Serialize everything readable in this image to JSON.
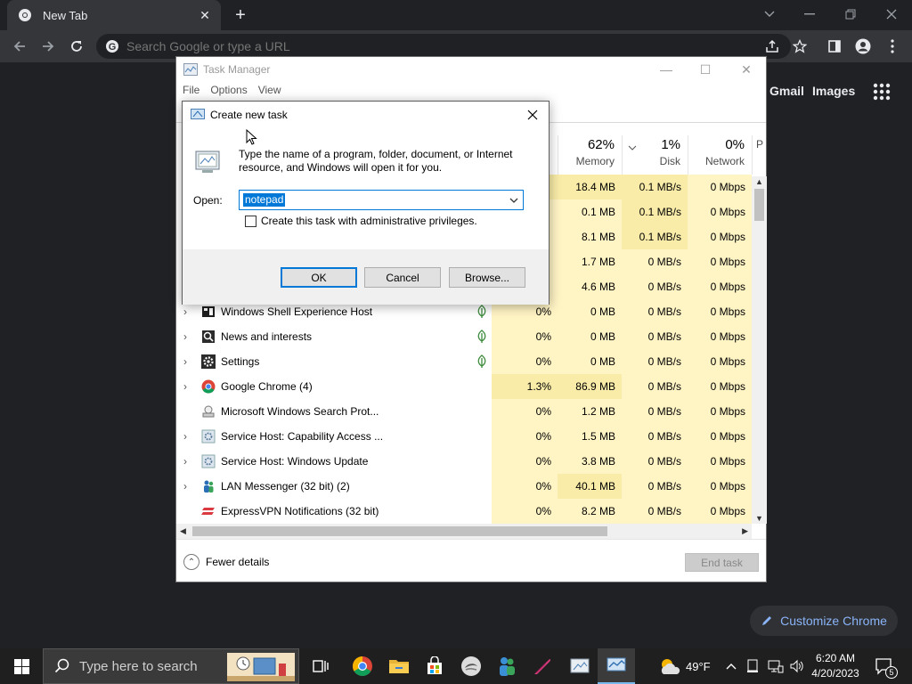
{
  "chrome": {
    "tab_title": "New Tab",
    "omnibox_placeholder": "Search Google or type a URL",
    "ntp_links": [
      "Gmail",
      "Images"
    ],
    "customize_label": "Customize Chrome"
  },
  "task_manager": {
    "title": "Task Manager",
    "menu": [
      "File",
      "Options",
      "View"
    ],
    "columns": [
      {
        "pct": "62%",
        "label": "Memory"
      },
      {
        "pct": "1%",
        "label": "Disk"
      },
      {
        "pct": "0%",
        "label": "Network"
      },
      {
        "pct": "",
        "label": "P"
      }
    ],
    "hidden_rows": [
      {
        "mem": "18.4 MB",
        "disk": "0.1 MB/s",
        "net": "0 Mbps"
      },
      {
        "mem": "0.1 MB",
        "disk": "0.1 MB/s",
        "net": "0 Mbps"
      },
      {
        "mem": "8.1 MB",
        "disk": "0.1 MB/s",
        "net": "0 Mbps"
      },
      {
        "mem": "1.7 MB",
        "disk": "0 MB/s",
        "net": "0 Mbps"
      },
      {
        "mem": "4.6 MB",
        "disk": "0 MB/s",
        "net": "0 Mbps"
      }
    ],
    "processes": [
      {
        "name": "Windows Shell Experience Host",
        "icon": "shell-icon",
        "expand": true,
        "suspended": true,
        "cpu": "0%",
        "mem": "0 MB",
        "disk": "0 MB/s",
        "net": "0 Mbps"
      },
      {
        "name": "News and interests",
        "icon": "news-icon",
        "expand": true,
        "suspended": true,
        "cpu": "0%",
        "mem": "0 MB",
        "disk": "0 MB/s",
        "net": "0 Mbps"
      },
      {
        "name": "Settings",
        "icon": "settings-gear-icon",
        "expand": true,
        "suspended": true,
        "cpu": "0%",
        "mem": "0 MB",
        "disk": "0 MB/s",
        "net": "0 Mbps"
      },
      {
        "name": "Google Chrome (4)",
        "icon": "chrome-icon",
        "expand": true,
        "suspended": false,
        "cpu": "1.3%",
        "mem": "86.9 MB",
        "disk": "0 MB/s",
        "net": "0 Mbps"
      },
      {
        "name": "Microsoft Windows Search Prot...",
        "icon": "search-protocol-icon",
        "expand": false,
        "suspended": false,
        "cpu": "0%",
        "mem": "1.2 MB",
        "disk": "0 MB/s",
        "net": "0 Mbps"
      },
      {
        "name": "Service Host: Capability Access ...",
        "icon": "service-host-icon",
        "expand": true,
        "suspended": false,
        "cpu": "0%",
        "mem": "1.5 MB",
        "disk": "0 MB/s",
        "net": "0 Mbps"
      },
      {
        "name": "Service Host: Windows Update",
        "icon": "service-host-icon",
        "expand": true,
        "suspended": false,
        "cpu": "0%",
        "mem": "3.8 MB",
        "disk": "0 MB/s",
        "net": "0 Mbps"
      },
      {
        "name": "LAN Messenger (32 bit) (2)",
        "icon": "lan-messenger-icon",
        "expand": true,
        "suspended": false,
        "cpu": "0%",
        "mem": "40.1 MB",
        "disk": "0 MB/s",
        "net": "0 Mbps"
      },
      {
        "name": "ExpressVPN Notifications (32 bit)",
        "icon": "expressvpn-icon",
        "expand": false,
        "suspended": false,
        "cpu": "0%",
        "mem": "8.2 MB",
        "disk": "0 MB/s",
        "net": "0 Mbps"
      }
    ],
    "fewer_details": "Fewer details",
    "end_task": "End task"
  },
  "dialog": {
    "title": "Create new task",
    "description": "Type the name of a program, folder, document, or Internet resource, and Windows will open it for you.",
    "open_label": "Open:",
    "open_value": "notepad",
    "admin_checkbox_label": "Create this task with administrative privileges.",
    "admin_checked": false,
    "ok": "OK",
    "cancel": "Cancel",
    "browse": "Browse..."
  },
  "taskbar": {
    "search_placeholder": "Type here to search",
    "weather": "49°F",
    "time": "6:20 AM",
    "date": "4/20/2023",
    "notification_count": "5"
  }
}
